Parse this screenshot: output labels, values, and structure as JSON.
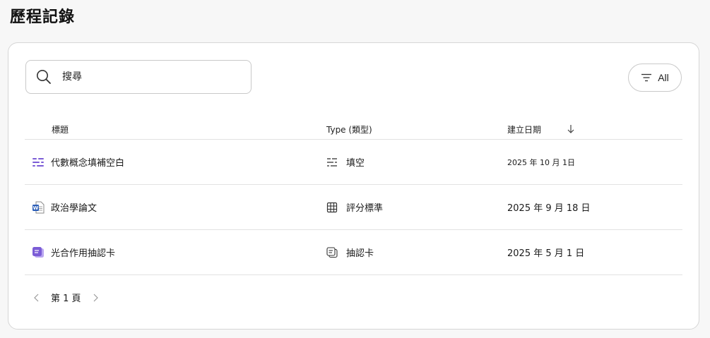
{
  "page": {
    "title": "歷程記錄"
  },
  "search": {
    "placeholder": "搜尋",
    "value": ""
  },
  "filter": {
    "label": "All",
    "icon": "filter-lines-icon"
  },
  "table": {
    "headers": {
      "title": "標題",
      "type": "Type (類型)",
      "date": "建立日期"
    },
    "sort_icon": "arrow-down-icon",
    "rows": [
      {
        "title": "代數概念填補空白",
        "title_icon": "fill-blank-icon",
        "type": "填空",
        "type_icon": "fill-blank-lines-icon",
        "date": "2025 年 10 月 1日"
      },
      {
        "title": "政治學論文",
        "title_icon": "word-document-icon",
        "type": "評分標準",
        "type_icon": "grid-table-icon",
        "date": "2025 年 9 月 18 日"
      },
      {
        "title": "光合作用抽認卡",
        "title_icon": "flashcard-icon",
        "type": "抽認卡",
        "type_icon": "flashcard-outline-icon",
        "date": "2025 年 5 月 1 日"
      }
    ]
  },
  "pager": {
    "label": "第 1 頁"
  },
  "colors": {
    "accent": "#7b5cd6",
    "word_blue": "#2b5eb8"
  }
}
